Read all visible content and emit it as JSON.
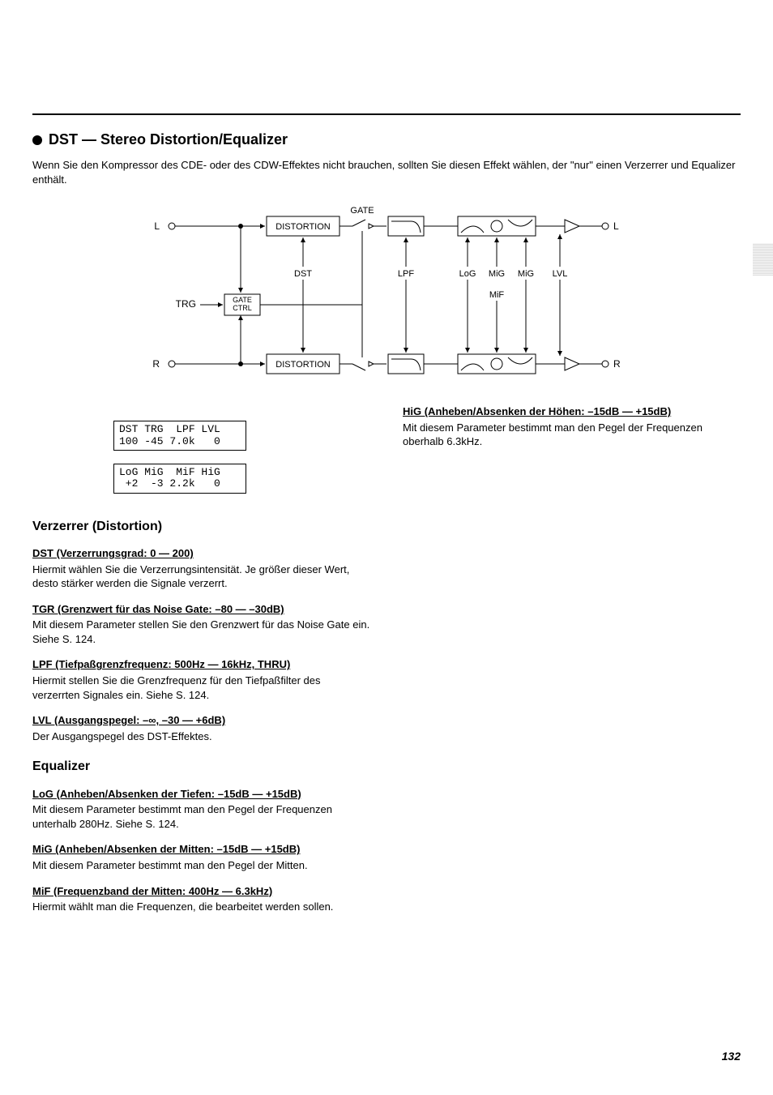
{
  "title": "DST — Stereo Distortion/Equalizer",
  "intro": "Wenn Sie den Kompressor des CDE- oder des CDW-Effektes nicht brauchen, sollten Sie diesen Effekt wählen, der \"nur\" einen Verzerrer und Equalizer enthält.",
  "diagram": {
    "io_left_in": "L",
    "io_left_out": "L",
    "io_right_in": "R",
    "io_right_out": "R",
    "trigger_in": "TRG",
    "gate_ctrl_label": "GATE\nCTRL",
    "distortion_label": "DISTORTION",
    "gate_label": "GATE",
    "param_dst": "DST",
    "param_lpf": "LPF",
    "param_log": "LoG",
    "param_mig": "MiG",
    "param_mif": "MiF",
    "param_lvl": "LVL"
  },
  "display1": {
    "line1": "DST TRG  LPF LVL",
    "line2": "100 -45 7.0k   0"
  },
  "display2": {
    "line1": "LoG MiG  MiF HiG",
    "line2": " +2  -3 2.2k   0"
  },
  "sections": {
    "distortion_heading": "Verzerrer (Distortion)",
    "equalizer_heading": "Equalizer"
  },
  "params": {
    "dst": {
      "heading": "DST (Verzerrungsgrad: 0 — 200)",
      "body": "Hiermit wählen Sie die Verzerrungsintensität. Je größer dieser Wert, desto stärker werden die Signale verzerrt."
    },
    "tgr": {
      "heading": "TGR (Grenzwert für das Noise Gate: –80 — –30dB)",
      "body": "Mit diesem Parameter stellen Sie den Grenzwert für das Noise Gate ein. Siehe S. 124."
    },
    "lpf": {
      "heading": "LPF (Tiefpaßgrenzfrequenz: 500Hz — 16kHz, THRU)",
      "body": "Hiermit stellen Sie die Grenzfrequenz für den Tiefpaßfilter des verzerrten Signales ein. Siehe S. 124."
    },
    "lvl": {
      "heading": "LVL (Ausgangspegel: –∞, –30 — +6dB)",
      "body": "Der Ausgangspegel des DST-Effektes."
    },
    "log": {
      "heading": "LoG (Anheben/Absenken der Tiefen: –15dB — +15dB)",
      "body": "Mit diesem Parameter bestimmt man den Pegel der Frequenzen unterhalb 280Hz. Siehe S. 124."
    },
    "mig": {
      "heading": "MiG (Anheben/Absenken der Mitten: –15dB — +15dB)",
      "body": "Mit diesem Parameter bestimmt man den Pegel der Mitten."
    },
    "mif": {
      "heading": "MiF (Frequenzband der Mitten: 400Hz — 6.3kHz)",
      "body": "Hiermit wählt man die Frequenzen, die bearbeitet werden sollen."
    },
    "hig": {
      "heading": "HiG (Anheben/Absenken der Höhen: –15dB — +15dB)",
      "body": "Mit diesem Parameter bestimmt man den Pegel der Frequenzen oberhalb 6.3kHz."
    }
  },
  "page_number": "132"
}
